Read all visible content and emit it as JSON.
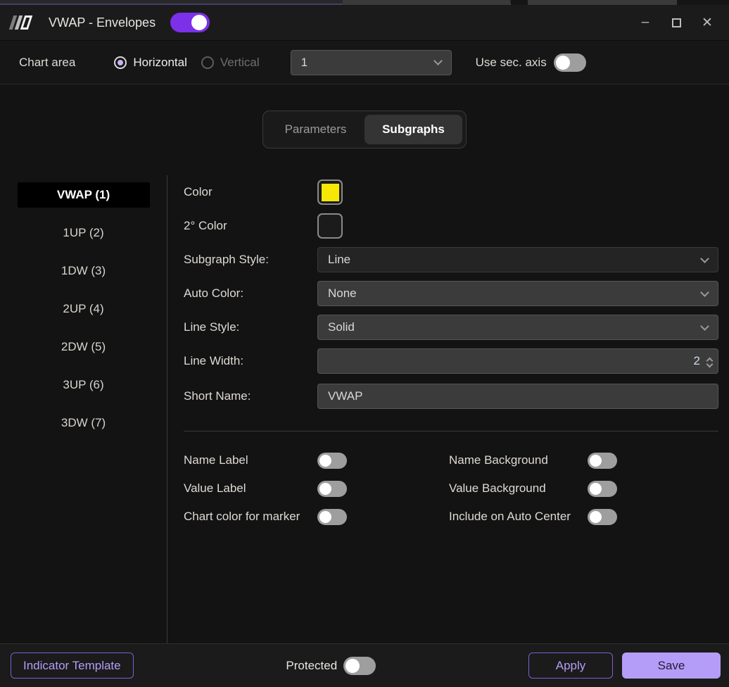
{
  "titlebar": {
    "title": "VWAP - Envelopes",
    "indicator_enabled_toggle_on": true,
    "window_icons": {
      "minimize": "–",
      "maximize": "□",
      "close": "✕"
    }
  },
  "chart_area": {
    "label": "Chart area",
    "orientation_options": [
      {
        "label": "Horizontal",
        "selected": true
      },
      {
        "label": "Vertical",
        "selected": false
      }
    ],
    "area_number": "1",
    "sec_axis": {
      "label": "Use sec. axis",
      "on": false
    }
  },
  "tabs": [
    {
      "label": "Parameters",
      "active": false
    },
    {
      "label": "Subgraphs",
      "active": true
    }
  ],
  "subgraph_list": [
    {
      "label": "VWAP (1)",
      "selected": true
    },
    {
      "label": "1UP (2)",
      "selected": false
    },
    {
      "label": "1DW (3)",
      "selected": false
    },
    {
      "label": "2UP (4)",
      "selected": false
    },
    {
      "label": "2DW (5)",
      "selected": false
    },
    {
      "label": "3UP (6)",
      "selected": false
    },
    {
      "label": "3DW (7)",
      "selected": false
    }
  ],
  "subgraph_settings": {
    "color": {
      "label": "Color",
      "value": "#f6e704"
    },
    "secondary_color": {
      "label": "2° Color",
      "value": ""
    },
    "subgraph_style": {
      "label": "Subgraph Style:",
      "value": "Line"
    },
    "auto_color": {
      "label": "Auto Color:",
      "value": "None"
    },
    "line_style": {
      "label": "Line Style:",
      "value": "Solid"
    },
    "line_width": {
      "label": "Line Width:",
      "value": "2"
    },
    "short_name": {
      "label": "Short Name:",
      "value": "VWAP"
    }
  },
  "display_toggles": {
    "left": [
      {
        "label": "Name Label",
        "on": false
      },
      {
        "label": "Value Label",
        "on": false
      },
      {
        "label": "Chart color for marker",
        "on": false
      }
    ],
    "right": [
      {
        "label": "Name Background",
        "on": false
      },
      {
        "label": "Value Background",
        "on": false
      },
      {
        "label": "Include on Auto Center",
        "on": false
      }
    ]
  },
  "footer": {
    "indicator_template_label": "Indicator Template",
    "protected": {
      "label": "Protected",
      "on": false
    },
    "apply_label": "Apply",
    "save_label": "Save"
  },
  "colors": {
    "accent_purple": "#7c30e8",
    "accent_light_purple": "#b49df8",
    "swatch_yellow": "#f6e704",
    "radio_accent": "#c9b2f5"
  }
}
